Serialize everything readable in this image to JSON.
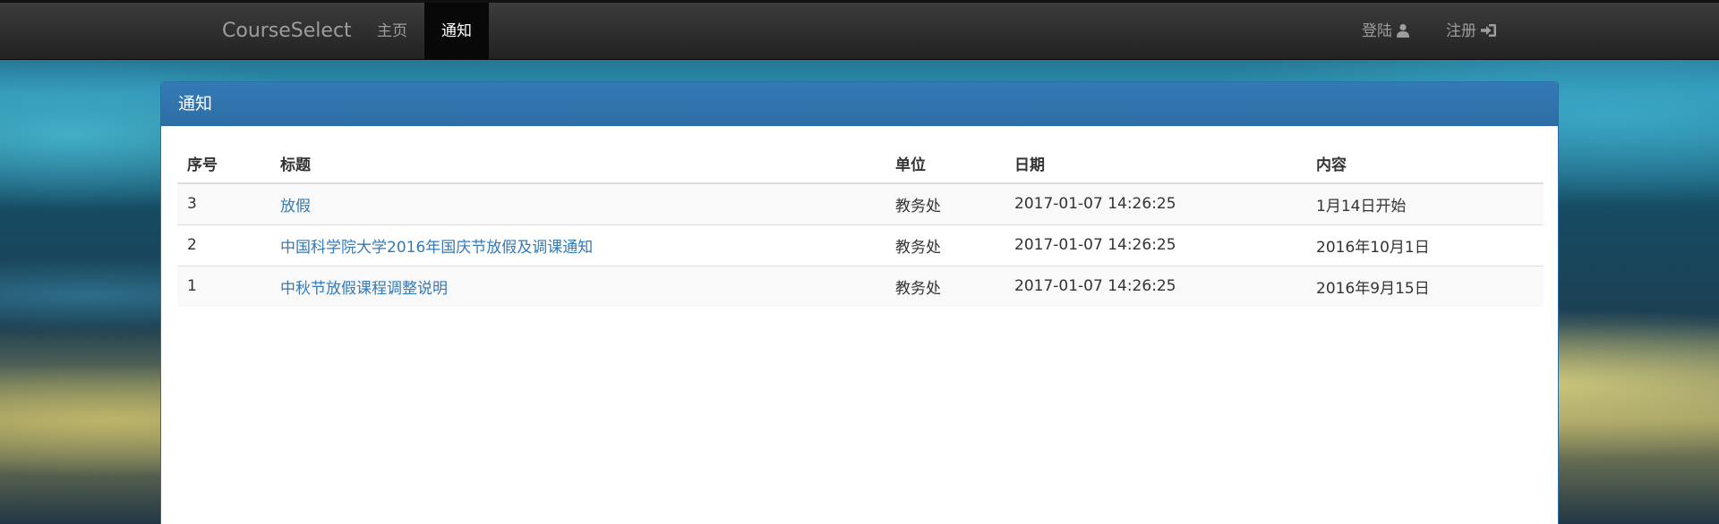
{
  "navbar": {
    "brand": "CourseSelect",
    "home_label": "主页",
    "notice_label": "通知",
    "login_label": "登陆",
    "register_label": "注册",
    "login_icon": "user-icon",
    "register_icon": "log-in-icon"
  },
  "panel": {
    "heading": "通知",
    "columns": [
      "序号",
      "标题",
      "单位",
      "日期",
      "内容"
    ],
    "rows": [
      {
        "id": "3",
        "title": "放假",
        "unit": "教务处",
        "date": "2017-01-07 14:26:25",
        "content": "1月14日开始"
      },
      {
        "id": "2",
        "title": "中国科学院大学2016年国庆节放假及调课通知",
        "unit": "教务处",
        "date": "2017-01-07 14:26:25",
        "content": "2016年10月1日"
      },
      {
        "id": "1",
        "title": "中秋节放假课程调整说明",
        "unit": "教务处",
        "date": "2017-01-07 14:26:25",
        "content": "2016年9月15日"
      }
    ]
  },
  "colors": {
    "navbar": "#222222",
    "active_nav": "#080808",
    "panel_primary": "#337ab7",
    "link": "#337ab7"
  }
}
